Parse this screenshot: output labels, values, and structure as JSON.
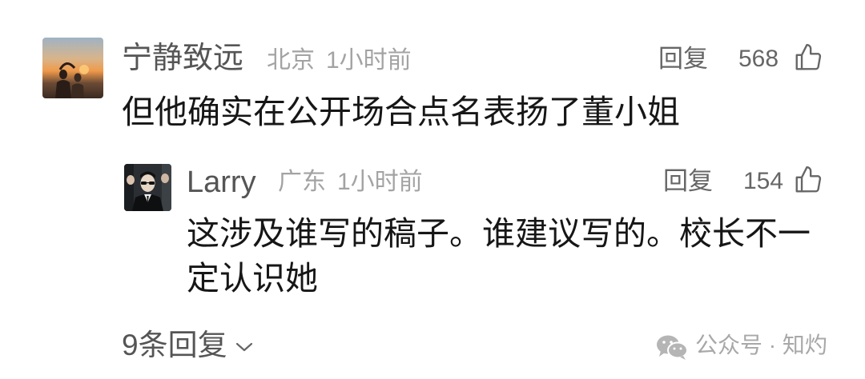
{
  "comment": {
    "username": "宁静致远",
    "location": "北京",
    "time": "1小时前",
    "reply_label": "回复",
    "likes": "568",
    "content": "但他确实在公开场合点名表扬了董小姐",
    "avatar_icon": "sunset-photo-avatar",
    "like_icon": "thumbs-up-icon"
  },
  "reply": {
    "username": "Larry",
    "location": "广东",
    "time": "1小时前",
    "reply_label": "回复",
    "likes": "154",
    "content": "这涉及谁写的稿子。谁建议写的。校长不一定认识她",
    "avatar_icon": "man-in-suit-avatar",
    "like_icon": "thumbs-up-icon"
  },
  "more_replies": {
    "label": "9条回复",
    "icon": "chevron-down-icon"
  },
  "watermark": {
    "text": "公众号 · 知灼",
    "icon": "wechat-icon"
  },
  "colors": {
    "username": "#555555",
    "meta": "#a3a3a3",
    "content": "#161616",
    "action": "#666666",
    "background": "#ffffff"
  }
}
